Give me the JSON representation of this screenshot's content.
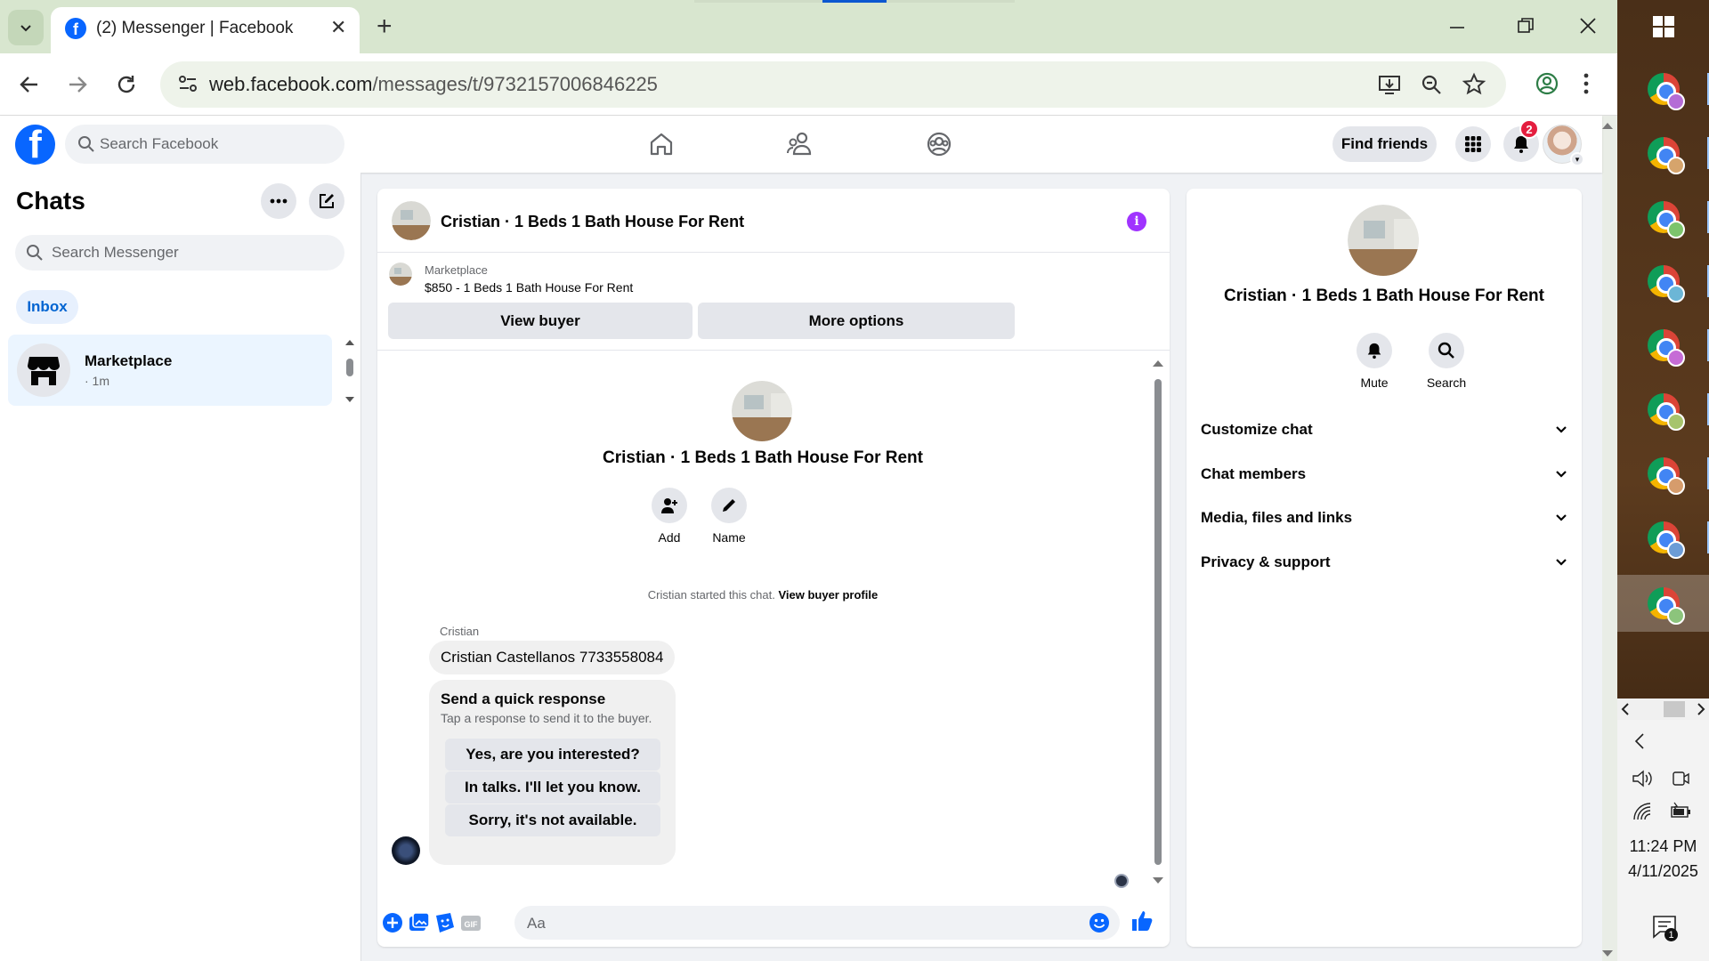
{
  "browser": {
    "tab_title": "(2) Messenger | Facebook",
    "tab_close": "✕",
    "new_tab": "+",
    "url_host": "web.facebook.com",
    "url_path": "/messages/t/9732157006846225"
  },
  "fb": {
    "logo_letter": "f",
    "search_placeholder": "Search Facebook",
    "find_friends": "Find friends",
    "notification_count": "2"
  },
  "chats": {
    "title": "Chats",
    "search_placeholder": "Search Messenger",
    "filter": "Inbox",
    "threads": [
      {
        "name": "Marketplace",
        "time": "· 1m"
      }
    ]
  },
  "conversation": {
    "title": "Cristian · 1 Beds 1 Bath House For Rent",
    "marketplace_label": "Marketplace",
    "listing": "$850 - 1 Beds 1 Bath House For Rent",
    "view_buyer": "View buyer",
    "more_options": "More options",
    "intro_name": "Cristian · 1 Beds 1 Bath House For Rent",
    "actions": [
      {
        "label": "Add",
        "icon": "add-person-icon"
      },
      {
        "label": "Name",
        "icon": "pencil-icon"
      }
    ],
    "started_text": "Cristian started this chat.",
    "view_buyer_profile": "View buyer profile",
    "sender": "Cristian",
    "message": "Cristian Castellanos 7733558084",
    "quick_response": {
      "title": "Send a quick response",
      "subtitle": "Tap a response to send it to the buyer.",
      "options": [
        "Yes, are you interested?",
        "In talks. I'll let you know.",
        "Sorry, it's not available."
      ]
    },
    "compose_placeholder": "Aa"
  },
  "details": {
    "name": "Cristian · 1 Beds 1 Bath House For Rent",
    "actions": [
      {
        "label": "Mute",
        "icon": "bell-icon"
      },
      {
        "label": "Search",
        "icon": "search-icon"
      }
    ],
    "sections": [
      "Customize chat",
      "Chat members",
      "Media, files and links",
      "Privacy & support"
    ]
  },
  "taskbar": {
    "time": "11:24 PM",
    "date": "4/11/2025",
    "notification_count": "1"
  },
  "colors": {
    "fb_blue": "#0866ff",
    "accent_purple": "#a033ff",
    "badge_red": "#e41e3f",
    "chrome_frame": "#d8e6cf"
  }
}
